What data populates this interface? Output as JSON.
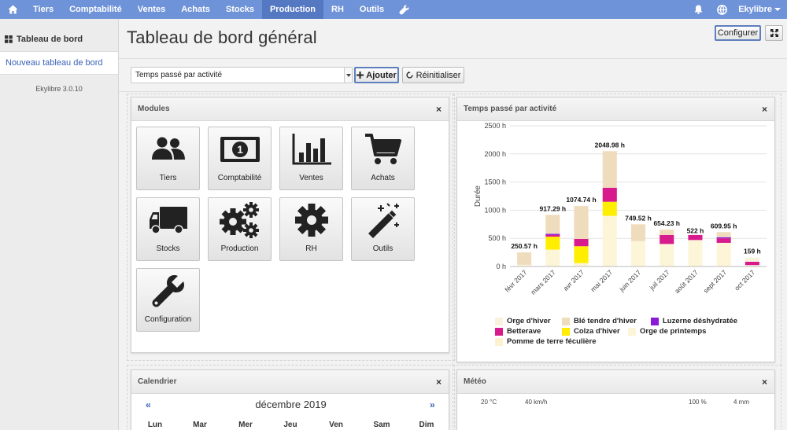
{
  "nav": {
    "items": [
      {
        "label": "Tiers",
        "name": "nav-item-tiers"
      },
      {
        "label": "Comptabilité",
        "name": "nav-item-comptabilite"
      },
      {
        "label": "Ventes",
        "name": "nav-item-ventes"
      },
      {
        "label": "Achats",
        "name": "nav-item-achats"
      },
      {
        "label": "Stocks",
        "name": "nav-item-stocks"
      },
      {
        "label": "Production",
        "name": "nav-item-production"
      },
      {
        "label": "RH",
        "name": "nav-item-rh"
      },
      {
        "label": "Outils",
        "name": "nav-item-outils"
      }
    ],
    "active": "Production",
    "user_label": "Ekylibre"
  },
  "sidebar": {
    "heading": "Tableau de bord",
    "link": "Nouveau tableau de bord",
    "version": "Ekylibre 3.0.10"
  },
  "main": {
    "title": "Tableau de bord général",
    "configure_label": "Configurer",
    "select_value": "Temps passé par activité",
    "add_label": "Ajouter",
    "reset_label": "Réinitialiser"
  },
  "modules_panel": {
    "title": "Modules",
    "items": [
      {
        "label": "Tiers",
        "icon": "users-icon"
      },
      {
        "label": "Comptabilité",
        "icon": "banknote-icon"
      },
      {
        "label": "Ventes",
        "icon": "bar-chart-icon"
      },
      {
        "label": "Achats",
        "icon": "cart-icon"
      },
      {
        "label": "Stocks",
        "icon": "truck-icon"
      },
      {
        "label": "Production",
        "icon": "gears-icon"
      },
      {
        "label": "RH",
        "icon": "gear-icon"
      },
      {
        "label": "Outils",
        "icon": "magic-wand-icon"
      },
      {
        "label": "Configuration",
        "icon": "wrench-icon"
      }
    ]
  },
  "chart_panel": {
    "title": "Temps passé par activité"
  },
  "chart_data": {
    "type": "bar",
    "stacked": true,
    "title": "",
    "ylabel": "Durée",
    "xlabel": "",
    "ylim": [
      0,
      2500
    ],
    "yticks": [
      0,
      500,
      1000,
      1500,
      2000,
      2500
    ],
    "ytick_labels": [
      "0 h",
      "500 h",
      "1000 h",
      "1500 h",
      "2000 h",
      "2500 h"
    ],
    "grid": true,
    "legend_position": "bottom",
    "categories": [
      "févr 2017",
      "mars 2017",
      "avr 2017",
      "mai 2017",
      "juin 2017",
      "juil 2017",
      "août 2017",
      "sept 2017",
      "oct 2017"
    ],
    "totals": [
      250.57,
      917.29,
      1074.74,
      2048.98,
      749.52,
      654.23,
      522,
      609.95,
      159
    ],
    "total_labels": [
      "250.57 h",
      "917.29 h",
      "1074.74 h",
      "2048.98 h",
      "749.52 h",
      "654.23 h",
      "522 h",
      "609.95 h",
      "159 h"
    ],
    "series": [
      {
        "name": "Orge de printemps",
        "color": "#fdf5d8",
        "values": [
          30,
          300,
          60,
          900,
          450,
          400,
          470,
          420,
          25
        ]
      },
      {
        "name": "Colza d'hiver",
        "color": "#ffee00",
        "values": [
          0,
          230,
          300,
          250,
          0,
          0,
          0,
          0,
          0
        ]
      },
      {
        "name": "Betterave",
        "color": "#d81b8c",
        "values": [
          0,
          30,
          130,
          250,
          0,
          160,
          90,
          80,
          60
        ]
      },
      {
        "name": "Luzerne déshydratée",
        "color": "#8b1ad8",
        "values": [
          0,
          20,
          0,
          0,
          0,
          0,
          0,
          20,
          0
        ]
      },
      {
        "name": "Blé tendre d'hiver",
        "color": "#efdcbc",
        "values": [
          220,
          337.29,
          584.74,
          648.98,
          299.52,
          94.23,
          0,
          89.95,
          0
        ]
      },
      {
        "name": "Orge d'hiver",
        "color": "#fbf2de",
        "values": [
          0,
          0,
          0,
          0,
          0,
          0,
          0,
          0,
          74
        ]
      },
      {
        "name": "Pomme de terre féculière",
        "color": "#fdf1cf",
        "values": [
          0.57,
          0,
          0,
          0,
          0,
          0,
          0,
          0,
          0
        ]
      }
    ],
    "legend": [
      {
        "name": "Orge d'hiver",
        "color": "#fbf2de"
      },
      {
        "name": "Blé tendre d'hiver",
        "color": "#efdcbc"
      },
      {
        "name": "Luzerne déshydratée",
        "color": "#8b1ad8"
      },
      {
        "name": "Betterave",
        "color": "#d81b8c"
      },
      {
        "name": "Colza d'hiver",
        "color": "#ffee00"
      },
      {
        "name": "Orge de printemps",
        "color": "#fdf5d8"
      },
      {
        "name": "Pomme de terre féculière",
        "color": "#fdf1cf"
      }
    ]
  },
  "calendar_panel": {
    "title": "Calendrier",
    "month": "décembre 2019",
    "prev": "«",
    "next": "»",
    "days": [
      "Lun",
      "Mar",
      "Mer",
      "Jeu",
      "Ven",
      "Sam",
      "Dim"
    ]
  },
  "meteo_panel": {
    "title": "Météo",
    "labels": [
      "20 °C",
      "40 km/h",
      "100 %",
      "4 mm"
    ]
  },
  "colors": {
    "nav_bg": "#6f93d8",
    "nav_active": "#5578c2",
    "link": "#3a62b8"
  }
}
